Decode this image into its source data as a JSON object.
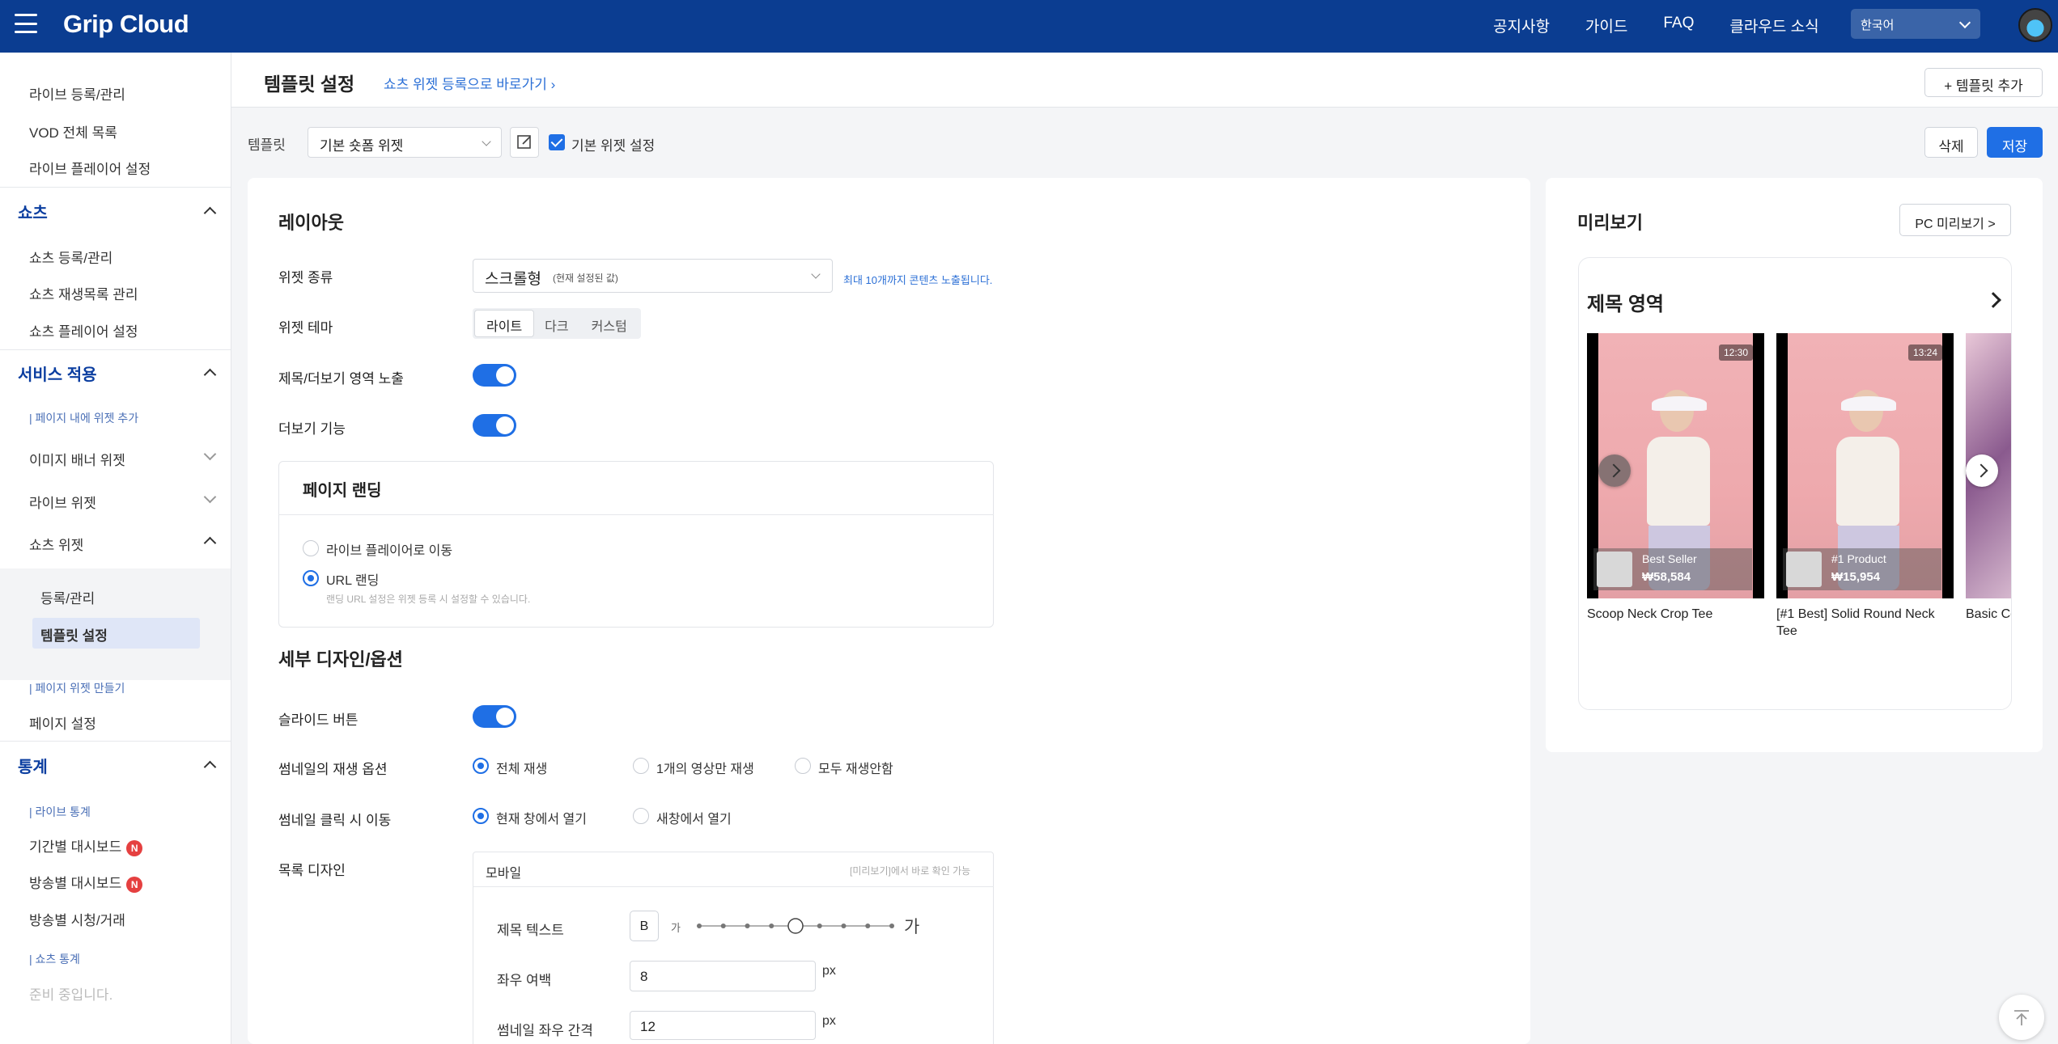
{
  "header": {
    "logo": "Grip Cloud",
    "nav": [
      "공지사항",
      "가이드",
      "FAQ",
      "클라우드 소식"
    ],
    "language": "한국어"
  },
  "sidebar": {
    "top_items": [
      "라이브 등록/관리",
      "VOD 전체 목록",
      "라이브 플레이어 설정"
    ],
    "shorts_section": "쇼츠",
    "shorts_items": [
      "쇼츠 등록/관리",
      "쇼츠 재생목록 관리",
      "쇼츠 플레이어 설정"
    ],
    "service_section": "서비스 적용",
    "service_sub": "페이지 내에 위젯 추가",
    "service_items": [
      "이미지 배너 위젯",
      "라이브 위젯",
      "쇼츠 위젯"
    ],
    "shorts_widget_items": [
      "등록/관리",
      "템플릿 설정"
    ],
    "page_widget_sub": "페이지 위젯 만들기",
    "page_settings": "페이지 설정",
    "stats_section": "통계",
    "live_stats_sub": "라이브 통계",
    "stats_items": [
      "기간별 대시보드",
      "방송별 대시보드",
      "방송별 시청/거래"
    ],
    "badge": "N",
    "shorts_stats_sub": "쇼츠 통계",
    "shorts_stats_placeholder": "준비 중입니다."
  },
  "page": {
    "title": "템플릿 설정",
    "shortcut": "쇼츠 위젯 등록으로 바로가기",
    "add_template": "템플릿 추가",
    "template_label": "템플릿",
    "template_value": "기본 숏폼 위젯",
    "default_widget_label": "기본 위젯 설정",
    "delete": "삭제",
    "save": "저장"
  },
  "layout_section": {
    "title": "레이아웃",
    "widget_type_label": "위젯 종류",
    "widget_type_value": "스크롤형",
    "widget_type_note": "(현재 설정된 값)",
    "widget_type_hint": "최대 10개까지 콘텐츠 노출됩니다.",
    "theme_label": "위젯 테마",
    "themes": [
      "라이트",
      "다크",
      "커스텀"
    ],
    "title_more_label": "제목/더보기 영역 노출",
    "more_label": "더보기 기능",
    "landing_title": "페이지 랜딩",
    "landing_options": [
      "라이브 플레이어로 이동",
      "URL 랜딩"
    ],
    "landing_hint": "랜딩 URL 설정은 위젯 등록 시 설정할 수 있습니다."
  },
  "design_section": {
    "title": "세부 디자인/옵션",
    "slide_label": "슬라이드 버튼",
    "thumb_play_label": "썸네일의 재생 옵션",
    "thumb_play_options": [
      "전체 재생",
      "1개의 영상만 재생",
      "모두 재생안함"
    ],
    "thumb_click_label": "썸네일 클릭 시 이동",
    "thumb_click_options": [
      "현재 창에서 열기",
      "새창에서 열기"
    ],
    "list_design_label": "목록 디자인",
    "mobile_label": "모바일",
    "mobile_hint": "[미리보기]에서 바로 확인 가능",
    "title_text_label": "제목 텍스트",
    "bold_label": "B",
    "size_small": "가",
    "size_large": "가",
    "size_level": 5,
    "side_margin_label": "좌우 여백",
    "side_margin_value": "8",
    "thumb_gap_label": "썸네일 좌우 간격",
    "thumb_gap_value": "12",
    "unit": "px"
  },
  "preview": {
    "title": "미리보기",
    "pc_button": "PC 미리보기 >",
    "area_title": "제목 영역",
    "items": [
      {
        "duration": "12:30",
        "badge": "Best Seller",
        "price": "₩58,584",
        "name": "Scoop Neck Crop Tee"
      },
      {
        "duration": "13:24",
        "badge": "#1 Product",
        "price": "₩15,954",
        "name": "[#1 Best] Solid Round Neck Tee"
      },
      {
        "duration": "",
        "badge": "",
        "price": "",
        "name": "Basic Co"
      }
    ]
  }
}
